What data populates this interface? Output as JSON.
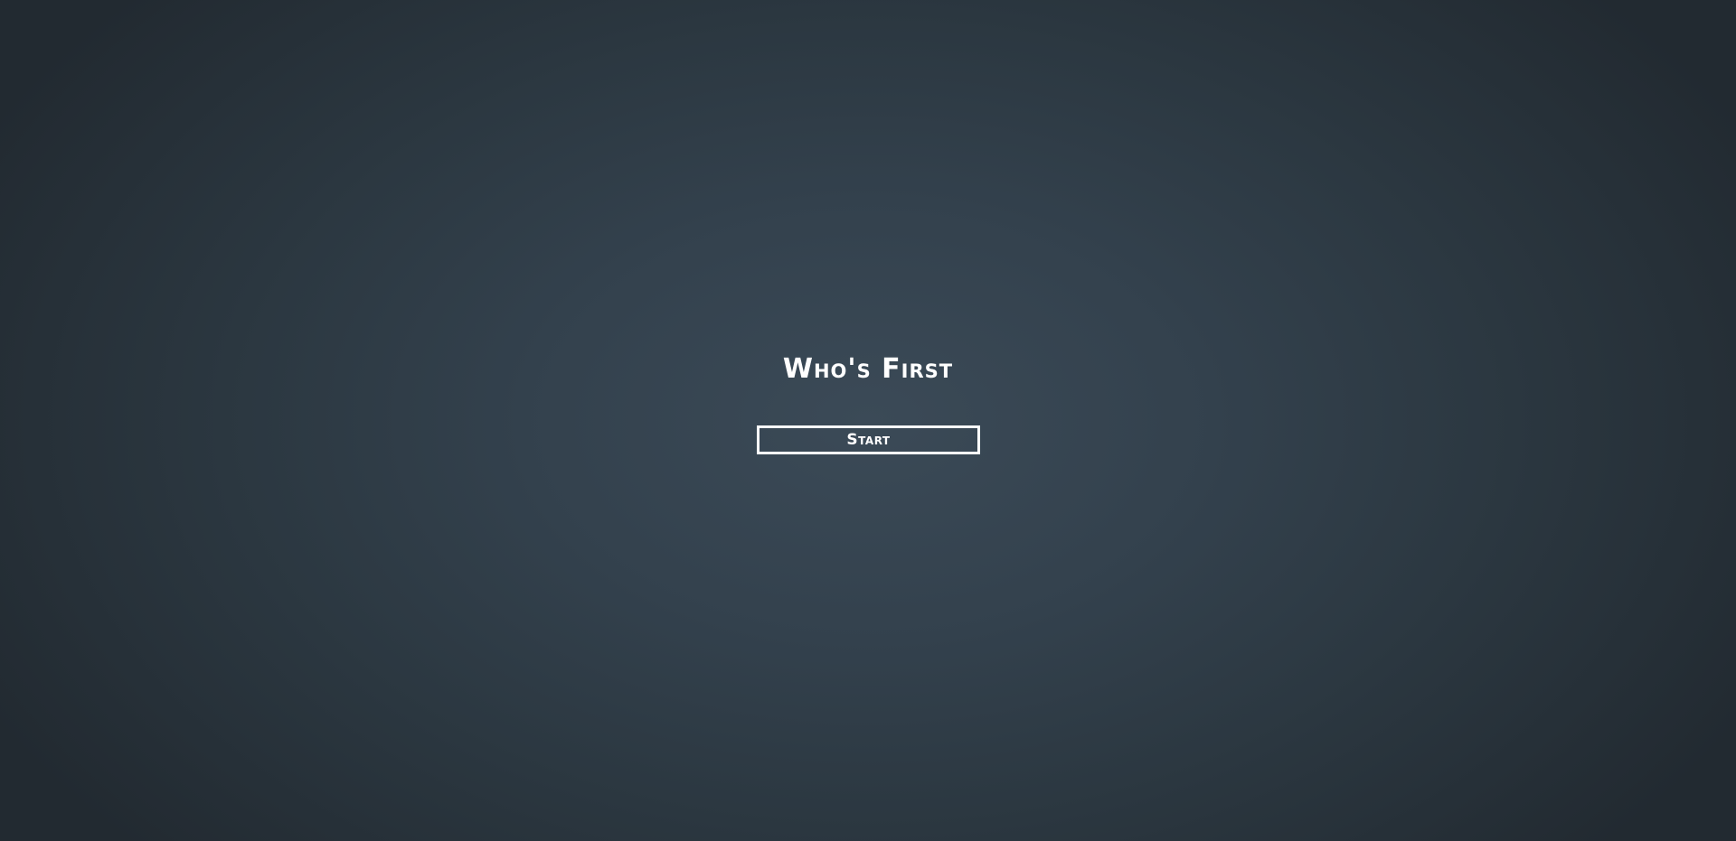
{
  "game": {
    "title": "Who's First",
    "start_label": "Start"
  },
  "colors": {
    "text": "#ffffff",
    "background_center": "#3b4a57",
    "background_edge": "#222a31",
    "button_border": "#ffffff"
  }
}
